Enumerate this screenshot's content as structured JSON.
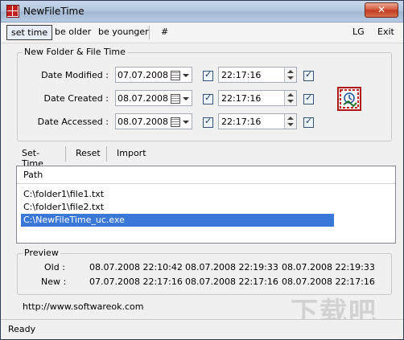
{
  "window": {
    "title": "NewFileTime",
    "close_label": "✕"
  },
  "menu": {
    "items": [
      "set time",
      "be older",
      "be younger",
      "#"
    ],
    "right_items": [
      "LG",
      "Exit"
    ]
  },
  "group": {
    "title": "New Folder & File Time"
  },
  "rows": [
    {
      "label": "Date Modified :",
      "date": "07.07.2008",
      "time": "22:17:16"
    },
    {
      "label": "Date Created :",
      "date": "08.07.2008",
      "time": "22:17:16"
    },
    {
      "label": "Date Accessed :",
      "date": "08.07.2008",
      "time": "22:17:16"
    }
  ],
  "tabs": [
    "Set-Time",
    "Reset",
    "Import"
  ],
  "list": {
    "header": "Path",
    "items": [
      "C:\\folder1\\file1.txt",
      "C:\\folder1\\file2.txt",
      "C:\\NewFileTime_uc.exe"
    ],
    "selected_index": 2
  },
  "preview": {
    "title": "Preview",
    "old_label": "Old :",
    "new_label": "New :",
    "old": [
      "08.07.2008 22:10:42",
      "08.07.2008 22:19:33",
      "08.07.2008 22:19:33"
    ],
    "new": [
      "07.07.2008 22:17:16",
      "08.07.2008 22:17:16",
      "08.07.2008 22:17:16"
    ]
  },
  "footer": {
    "link": "http://www.softwareok.com",
    "status": "Ready"
  },
  "watermark": "下载吧"
}
